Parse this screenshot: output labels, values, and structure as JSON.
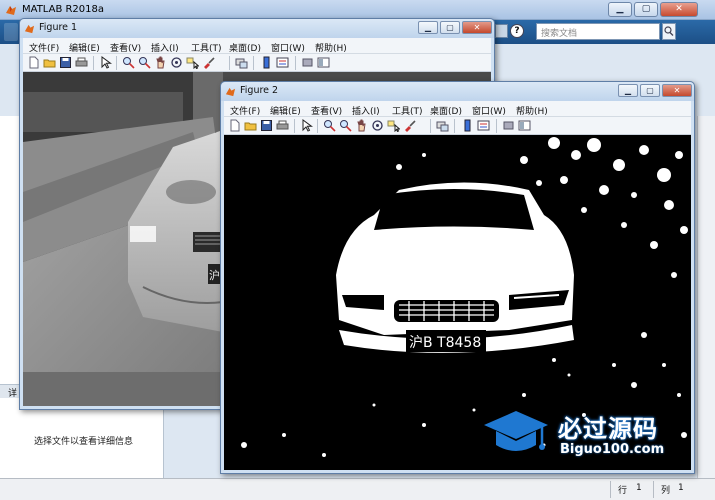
{
  "main_window": {
    "title": "MATLAB R2018a",
    "search_placeholder": "搜索文档",
    "help_label": "?",
    "detail_message": "选择文件以查看详细信息",
    "detail_header": "详"
  },
  "status_bar": {
    "row_label": "行",
    "row_value": "1",
    "col_label": "列",
    "col_value": "1"
  },
  "figure1": {
    "title": "Figure 1",
    "menu": [
      "文件(F)",
      "编辑(E)",
      "查看(V)",
      "插入(I)",
      "工具(T)",
      "桌面(D)",
      "窗口(W)",
      "帮助(H)"
    ],
    "plate_partial": "沪",
    "image_type": "grayscale car photo"
  },
  "figure2": {
    "title": "Figure 2",
    "menu": [
      "文件(F)",
      "编辑(E)",
      "查看(V)",
      "插入(I)",
      "工具(T)",
      "桌面(D)",
      "窗口(W)",
      "帮助(H)"
    ],
    "plate_text": "沪B T8458",
    "image_type": "binarized car photo"
  },
  "toolbar_icons": [
    "new-file-icon",
    "open-folder-icon",
    "save-icon",
    "print-icon",
    "pointer-icon",
    "zoom-in-icon",
    "zoom-out-icon",
    "pan-icon",
    "rotate-icon",
    "data-cursor-icon",
    "brush-icon",
    "link-icon",
    "colorbar-icon",
    "legend-icon",
    "hide-plot-tools-icon",
    "show-plot-tools-icon"
  ],
  "watermark": {
    "title": "必过源码",
    "url": "Biguo100.com"
  },
  "colors": {
    "ribbon": "#1c4f86",
    "title_bar": "#bfd4ec",
    "close_button": "#c4482d",
    "watermark_blue": "#1f78d1"
  }
}
